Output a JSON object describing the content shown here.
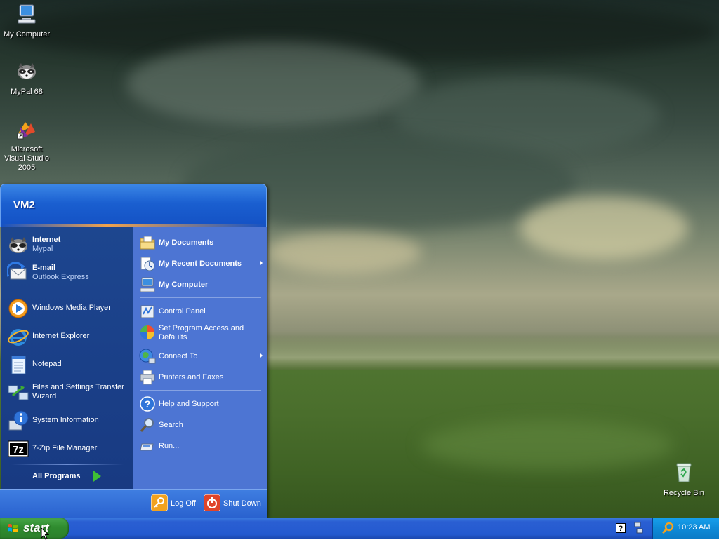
{
  "desktop": {
    "icons": [
      {
        "label": "My Computer",
        "icon": "my-computer-icon"
      },
      {
        "label": "MyPal 68",
        "icon": "raccoon-icon"
      },
      {
        "label": "Microsoft Visual Studio 2005",
        "icon": "visual-studio-icon"
      },
      {
        "label": "Recycle Bin",
        "icon": "recycle-bin-icon"
      }
    ]
  },
  "start_menu": {
    "user_name": "VM2",
    "pinned": [
      {
        "title": "Internet",
        "subtitle": "Mypal",
        "icon": "raccoon-icon"
      },
      {
        "title": "E-mail",
        "subtitle": "Outlook Express",
        "icon": "outlook-express-icon"
      }
    ],
    "recent": [
      {
        "label": "Windows Media Player",
        "icon": "media-player-icon"
      },
      {
        "label": "Internet Explorer",
        "icon": "internet-explorer-icon"
      },
      {
        "label": "Notepad",
        "icon": "notepad-icon"
      },
      {
        "label": "Files and Settings Transfer Wizard",
        "icon": "transfer-wizard-icon"
      },
      {
        "label": "System Information",
        "icon": "system-information-icon"
      },
      {
        "label": "7-Zip File Manager",
        "icon": "7zip-icon"
      }
    ],
    "all_programs": "All Programs",
    "right": [
      {
        "label": "My Documents",
        "icon": "my-documents-icon",
        "bold": true
      },
      {
        "label": "My Recent Documents",
        "icon": "recent-documents-icon",
        "bold": true,
        "submenu": true
      },
      {
        "label": "My Computer",
        "icon": "my-computer-icon",
        "bold": true
      },
      {
        "label": "Control Panel",
        "icon": "control-panel-icon"
      },
      {
        "label": "Set Program Access and Defaults",
        "icon": "program-access-icon"
      },
      {
        "label": "Connect To",
        "icon": "connect-to-icon",
        "submenu": true
      },
      {
        "label": "Printers and Faxes",
        "icon": "printer-icon"
      },
      {
        "label": "Help and Support",
        "icon": "help-icon"
      },
      {
        "label": "Search",
        "icon": "search-icon"
      },
      {
        "label": "Run...",
        "icon": "run-icon"
      }
    ],
    "log_off": "Log Off",
    "shut_down": "Shut Down"
  },
  "taskbar": {
    "start_label": "start",
    "clock": "10:23 AM"
  },
  "colors": {
    "taskbar_blue": "#245ad0",
    "start_green": "#2f8c2f",
    "menu_left": "#1d468f",
    "menu_right": "#4d75d3",
    "tray_blue": "#0e8ad8"
  }
}
